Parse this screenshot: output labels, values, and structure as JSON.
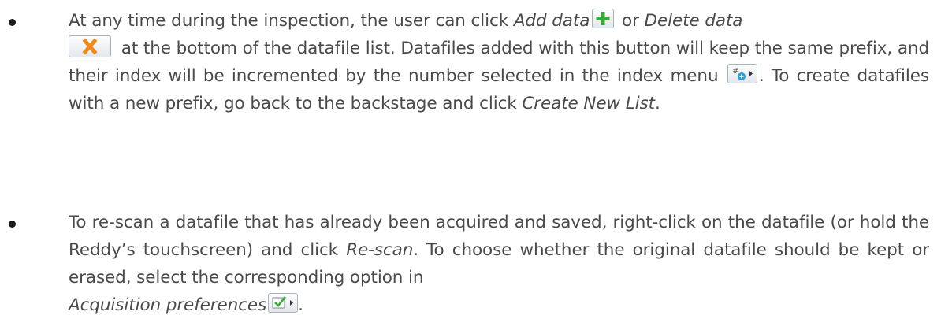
{
  "bullets": [
    {
      "t1": "At any time during the inspection, the user can click ",
      "add_data": "Add data",
      "t2": " or ",
      "delete_data": "Delete data",
      "t3": " at the bottom of the datafile list. Datafiles added with this button will keep the same prefix, and their index will be incremented by the number selected in the index menu ",
      "t4": ". To create datafiles with a new prefix, go back to the backstage and click ",
      "create_new_list": "Create New List",
      "t5": "."
    },
    {
      "t1": "To re-scan a datafile that has already been acquired and saved, right-click on the datafile (or hold the Reddy’s touchscreen) and click ",
      "rescan": "Re-scan",
      "t2": ". To choose whether the original datafile should be kept or erased, select the corresponding option in ",
      "acq_prefs": "Acquisition preferences",
      "t3": "."
    }
  ],
  "icons": {
    "add": "plus-icon",
    "delete": "x-icon",
    "index": "index-menu-icon",
    "preferences": "checkbox-menu-icon"
  },
  "colors": {
    "text": "#4a4a4a",
    "add_green": "#3aa83a",
    "delete_orange": "#f08a1c",
    "index_blue": "#2a9fd8",
    "pref_green": "#3aa83a"
  }
}
